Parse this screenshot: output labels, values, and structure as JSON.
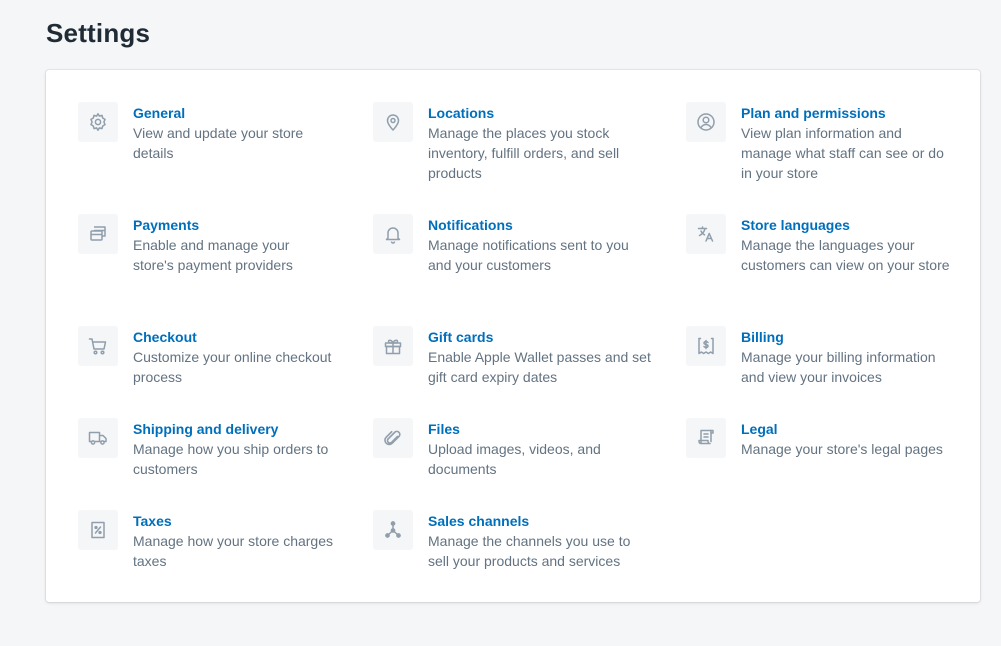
{
  "page": {
    "title": "Settings"
  },
  "colors": {
    "link": "#006fbb",
    "description": "#637381",
    "icon": "#919eab",
    "background": "#f4f6f8"
  },
  "settings": {
    "general": {
      "title": "General",
      "description": "View and update your store details",
      "icon": "gear-icon"
    },
    "locations": {
      "title": "Locations",
      "description": "Manage the places you stock inventory, fulfill orders, and sell products",
      "icon": "location-pin-icon"
    },
    "plan": {
      "title": "Plan and permissions",
      "description": "View plan information and manage what staff can see or do in your store",
      "icon": "user-circle-icon"
    },
    "payments": {
      "title": "Payments",
      "description": "Enable and manage your store's payment providers",
      "icon": "payment-cards-icon"
    },
    "notifications": {
      "title": "Notifications",
      "description": "Manage notifications sent to you and your customers",
      "icon": "bell-icon"
    },
    "languages": {
      "title": "Store languages",
      "description": "Manage the languages your customers can view on your store",
      "icon": "translate-icon"
    },
    "checkout": {
      "title": "Checkout",
      "description": "Customize your online checkout process",
      "icon": "cart-icon"
    },
    "giftcards": {
      "title": "Gift cards",
      "description": "Enable Apple Wallet passes and set gift card expiry dates",
      "icon": "gift-icon"
    },
    "billing": {
      "title": "Billing",
      "description": "Manage your billing information and view your invoices",
      "icon": "billing-icon"
    },
    "shipping": {
      "title": "Shipping and delivery",
      "description": "Manage how you ship orders to customers",
      "icon": "truck-icon"
    },
    "files": {
      "title": "Files",
      "description": "Upload images, videos, and documents",
      "icon": "paperclip-icon"
    },
    "legal": {
      "title": "Legal",
      "description": "Manage your store's legal pages",
      "icon": "legal-document-icon"
    },
    "taxes": {
      "title": "Taxes",
      "description": "Manage how your store charges taxes",
      "icon": "tax-receipt-icon"
    },
    "channels": {
      "title": "Sales channels",
      "description": "Manage the channels you use to sell your products and services",
      "icon": "channels-icon"
    }
  }
}
